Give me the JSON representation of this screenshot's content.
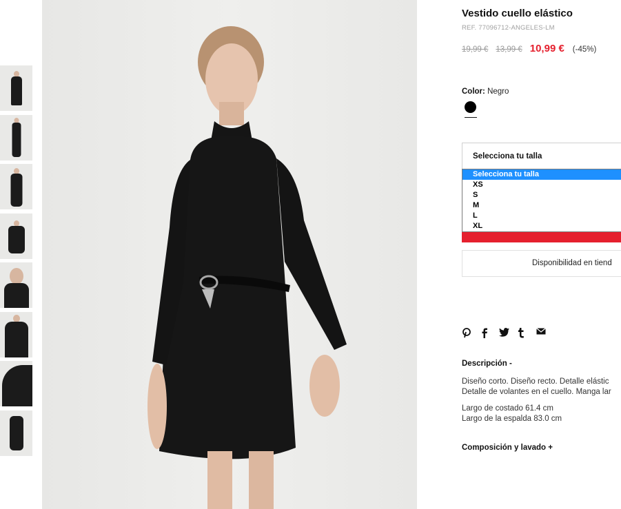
{
  "product": {
    "title": "Vestido cuello elástico",
    "ref": "REF. 77096712-ANGELES-LM"
  },
  "prices": {
    "original": "19,99 €",
    "previous": "13,99 €",
    "current": "10,99 €",
    "discount": "(-45%)"
  },
  "color": {
    "label": "Color:",
    "value": "Negro",
    "swatch_hex": "#000000"
  },
  "size": {
    "selected": "Selecciona tu talla",
    "options": [
      "Selecciona tu talla",
      "XS",
      "S",
      "M",
      "L",
      "XL"
    ]
  },
  "availability_label": "Disponibilidad en tiend",
  "social_icons": [
    "pinterest-icon",
    "facebook-icon",
    "twitter-icon",
    "tumblr-icon",
    "email-icon"
  ],
  "description": {
    "heading": "Descripción -",
    "line1": "Diseño corto. Diseño recto. Detalle elástic",
    "line2": "Detalle de volantes en el cuello. Manga lar",
    "measure1": "Largo de costado 61.4 cm",
    "measure2": "Largo de la espalda 83.0 cm"
  },
  "composition_heading": "Composición y lavado +",
  "colors": {
    "accent_red": "#e5202e",
    "select_highlight": "#1e90ff"
  }
}
